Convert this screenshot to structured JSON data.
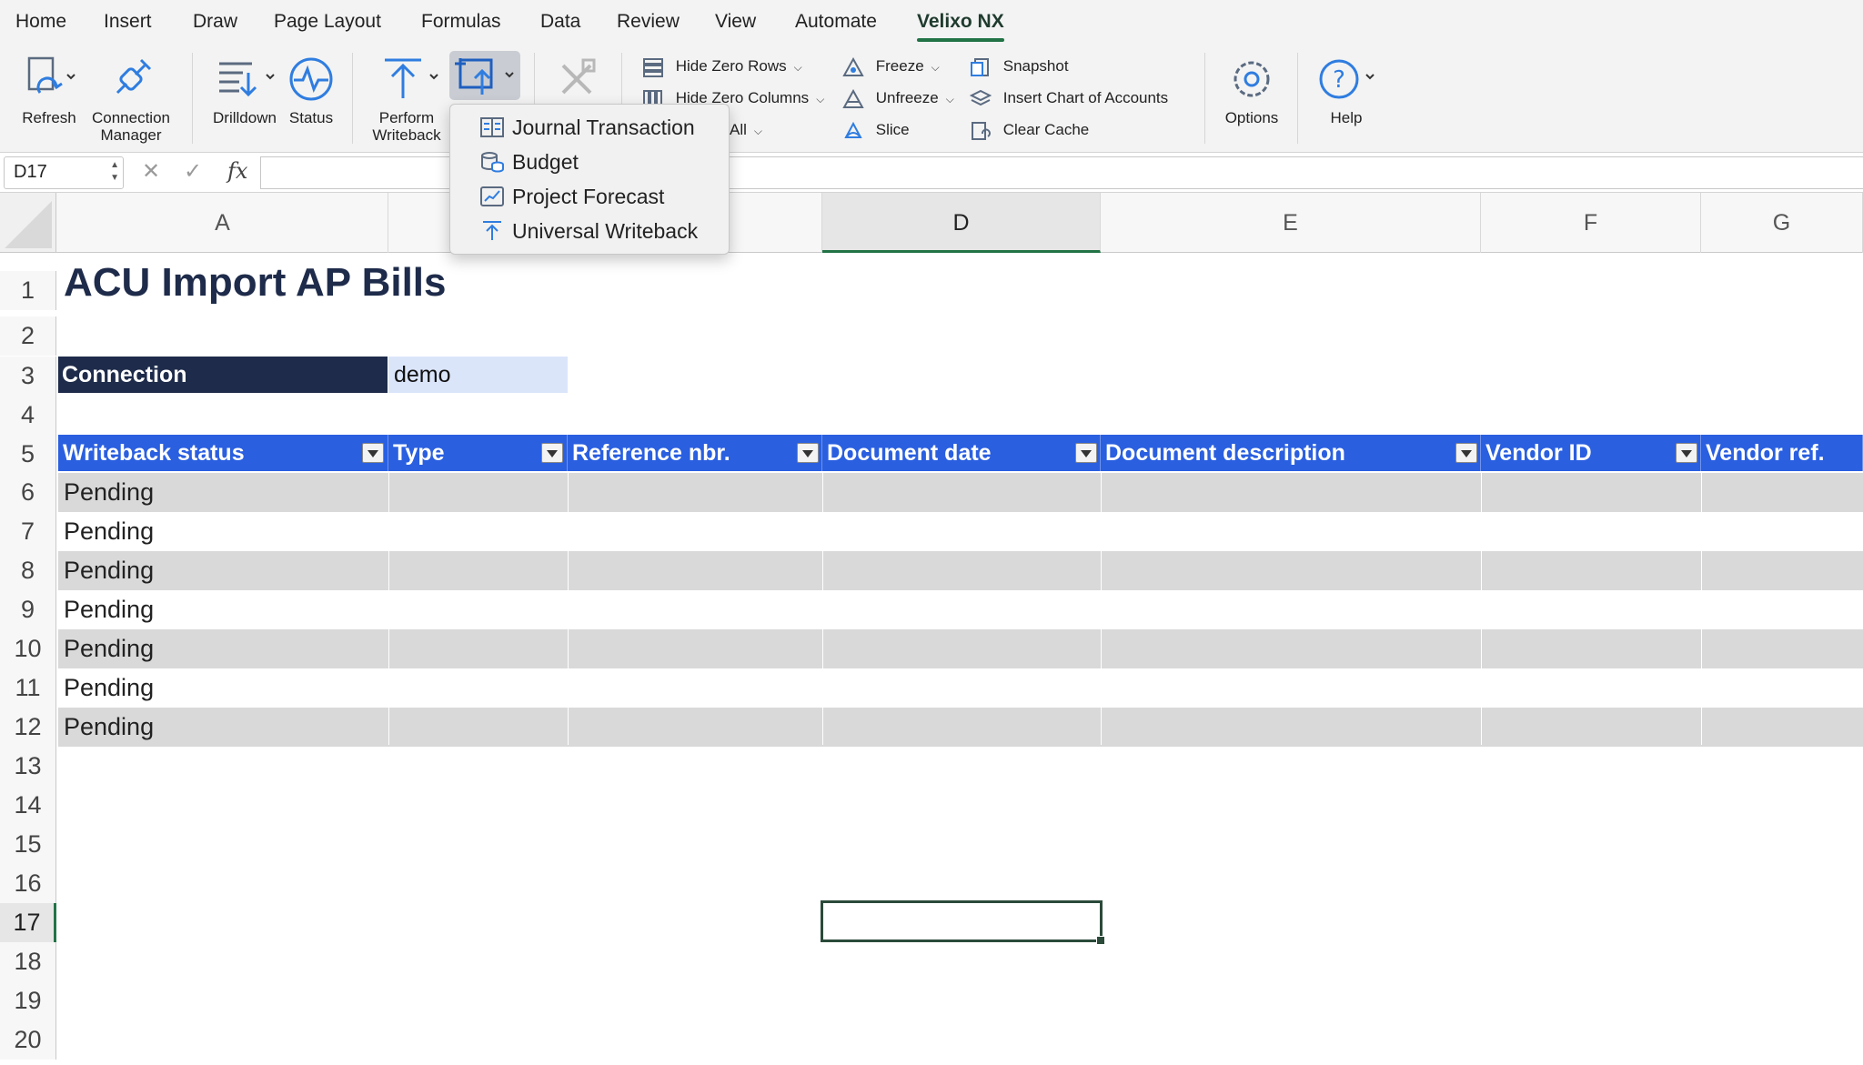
{
  "ribbon_tabs": [
    "Home",
    "Insert",
    "Draw",
    "Page Layout",
    "Formulas",
    "Data",
    "Review",
    "View",
    "Automate",
    "Velixo NX"
  ],
  "ribbon": {
    "refresh": "Refresh",
    "connection_manager": [
      "Connection",
      "Manager"
    ],
    "drilldown": "Drilldown",
    "status": "Status",
    "perform_writeback": [
      "Perform",
      "Writeback"
    ],
    "hide_zero_rows": "Hide Zero Rows",
    "hide_zero_columns": "Hide Zero Columns",
    "all": "All",
    "freeze": "Freeze",
    "unfreeze": "Unfreeze",
    "slice": "Slice",
    "snapshot": "Snapshot",
    "insert_chart_of_accounts": "Insert Chart of Accounts",
    "clear_cache": "Clear Cache",
    "options": "Options",
    "help": "Help"
  },
  "writeback_menu": [
    "Journal Transaction",
    "Budget",
    "Project Forecast",
    "Universal Writeback"
  ],
  "formula_bar": {
    "name_box": "D17",
    "fx": "fx",
    "cancel": "✕",
    "confirm": "✓"
  },
  "columns": [
    "A",
    "D",
    "E",
    "F",
    "G"
  ],
  "rows": [
    "1",
    "2",
    "3",
    "4",
    "5",
    "6",
    "7",
    "8",
    "9",
    "10",
    "11",
    "12",
    "13",
    "14",
    "15",
    "16",
    "17",
    "18",
    "19",
    "20"
  ],
  "sheet": {
    "title": "ACU Import AP Bills",
    "connection_label": "Connection",
    "connection_value": "demo",
    "headers": [
      "Writeback status",
      "Type",
      "Reference nbr.",
      "Document date",
      "Document description",
      "Vendor ID",
      "Vendor ref."
    ],
    "status_values": [
      "Pending",
      "Pending",
      "Pending",
      "Pending",
      "Pending",
      "Pending",
      "Pending"
    ]
  },
  "colors": {
    "accent": "#217346",
    "header_blue": "#2a5fe0",
    "navy": "#1e2b4a",
    "light_blue": "#dbe5fa"
  }
}
